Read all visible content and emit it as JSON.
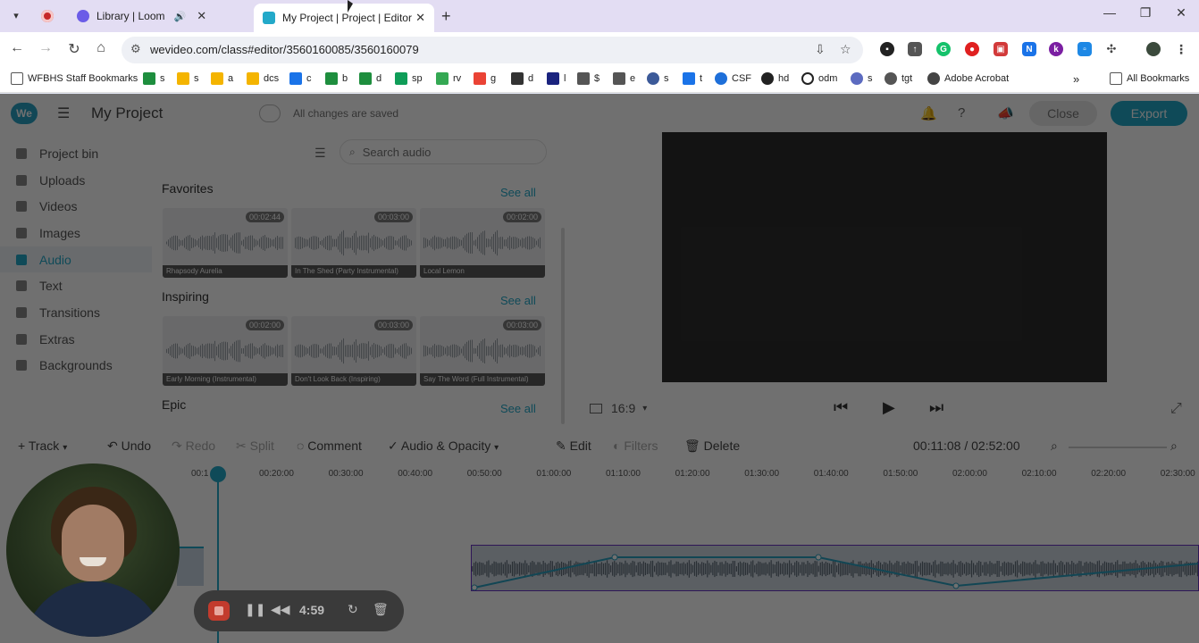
{
  "browser": {
    "tabs": [
      {
        "title": "",
        "state": "recording-tab"
      },
      {
        "title": "Library | Loom",
        "state": "inactive"
      },
      {
        "title": "My Project | Project | Editor | W",
        "state": "active"
      }
    ],
    "url": "wevideo.com/class#editor/3560160085/3560160079",
    "bookmarks": [
      {
        "label": "WFBHS Staff Bookmarks",
        "color": "#555555"
      },
      {
        "label": "s",
        "color": "#1e8e3e"
      },
      {
        "label": "s",
        "color": "#f4b400"
      },
      {
        "label": "a",
        "color": "#f4b400"
      },
      {
        "label": "dcs",
        "color": "#f4b400"
      },
      {
        "label": "c",
        "color": "#1a73e8"
      },
      {
        "label": "b",
        "color": "#1e8e3e"
      },
      {
        "label": "d",
        "color": "#1e8e3e"
      },
      {
        "label": "sp",
        "color": "#0f9d58"
      },
      {
        "label": "rv",
        "color": "#34a853"
      },
      {
        "label": "g",
        "color": "#ea4335"
      },
      {
        "label": "d",
        "color": "#333333"
      },
      {
        "label": "l",
        "color": "#1a237e"
      },
      {
        "label": "$",
        "color": "#555555"
      },
      {
        "label": "e",
        "color": "#555555"
      },
      {
        "label": "s",
        "color": "#3c5a99"
      },
      {
        "label": "t",
        "color": "#1a73e8"
      },
      {
        "label": "CSF",
        "color": "#1e6fd9"
      },
      {
        "label": "hd",
        "color": "#222222"
      },
      {
        "label": "odm",
        "color": "#222222"
      },
      {
        "label": "s",
        "color": "#5c6bc0"
      },
      {
        "label": "tgt",
        "color": "#555555"
      },
      {
        "label": "Adobe Acrobat",
        "color": "#444444"
      }
    ],
    "all_bookmarks": "All Bookmarks",
    "more_bookmarks": "»"
  },
  "app": {
    "logo": "We",
    "project_title": "My Project",
    "save_status": "All changes are saved",
    "close_label": "Close",
    "export_label": "Export",
    "nav": [
      {
        "label": "Project bin",
        "active": false
      },
      {
        "label": "Uploads",
        "active": false
      },
      {
        "label": "Videos",
        "active": false
      },
      {
        "label": "Images",
        "active": false
      },
      {
        "label": "Audio",
        "active": true
      },
      {
        "label": "Text",
        "active": false
      },
      {
        "label": "Transitions",
        "active": false
      },
      {
        "label": "Extras",
        "active": false
      },
      {
        "label": "Backgrounds",
        "active": false
      }
    ],
    "search_placeholder": "Search audio",
    "sections": [
      {
        "title": "Favorites",
        "see_all": "See all",
        "tiles": [
          {
            "duration": "00:02:44",
            "name": "Rhapsody Aurelia"
          },
          {
            "duration": "00:03:00",
            "name": "In The Shed (Party Instrumental)"
          },
          {
            "duration": "00:02:00",
            "name": "Local Lemon"
          }
        ]
      },
      {
        "title": "Inspiring",
        "see_all": "See all",
        "tiles": [
          {
            "duration": "00:02:00",
            "name": "Early Morning (Instrumental)"
          },
          {
            "duration": "00:03:00",
            "name": "Don't Look Back (Inspiring)"
          },
          {
            "duration": "00:03:00",
            "name": "Say The Word (Full Instrumental)"
          }
        ]
      },
      {
        "title": "Epic",
        "see_all": "See all",
        "tiles": []
      }
    ],
    "aspect_ratio": "16:9",
    "timeline_toolbar": {
      "track": "Track",
      "undo": "Undo",
      "redo": "Redo",
      "split": "Split",
      "comment": "Comment",
      "audio_opacity": "Audio & Opacity",
      "edit": "Edit",
      "filters": "Filters",
      "delete": "Delete",
      "timecode": "00:11:08 / 02:52:00"
    },
    "ruler_ticks": [
      "00:1",
      "00:20:00",
      "00:30:00",
      "00:40:00",
      "00:50:00",
      "01:00:00",
      "01:10:00",
      "01:20:00",
      "01:30:00",
      "01:40:00",
      "01:50:00",
      "02:00:00",
      "02:10:00",
      "02:20:00",
      "02:30:00"
    ]
  },
  "loom": {
    "timer": "4:59"
  }
}
